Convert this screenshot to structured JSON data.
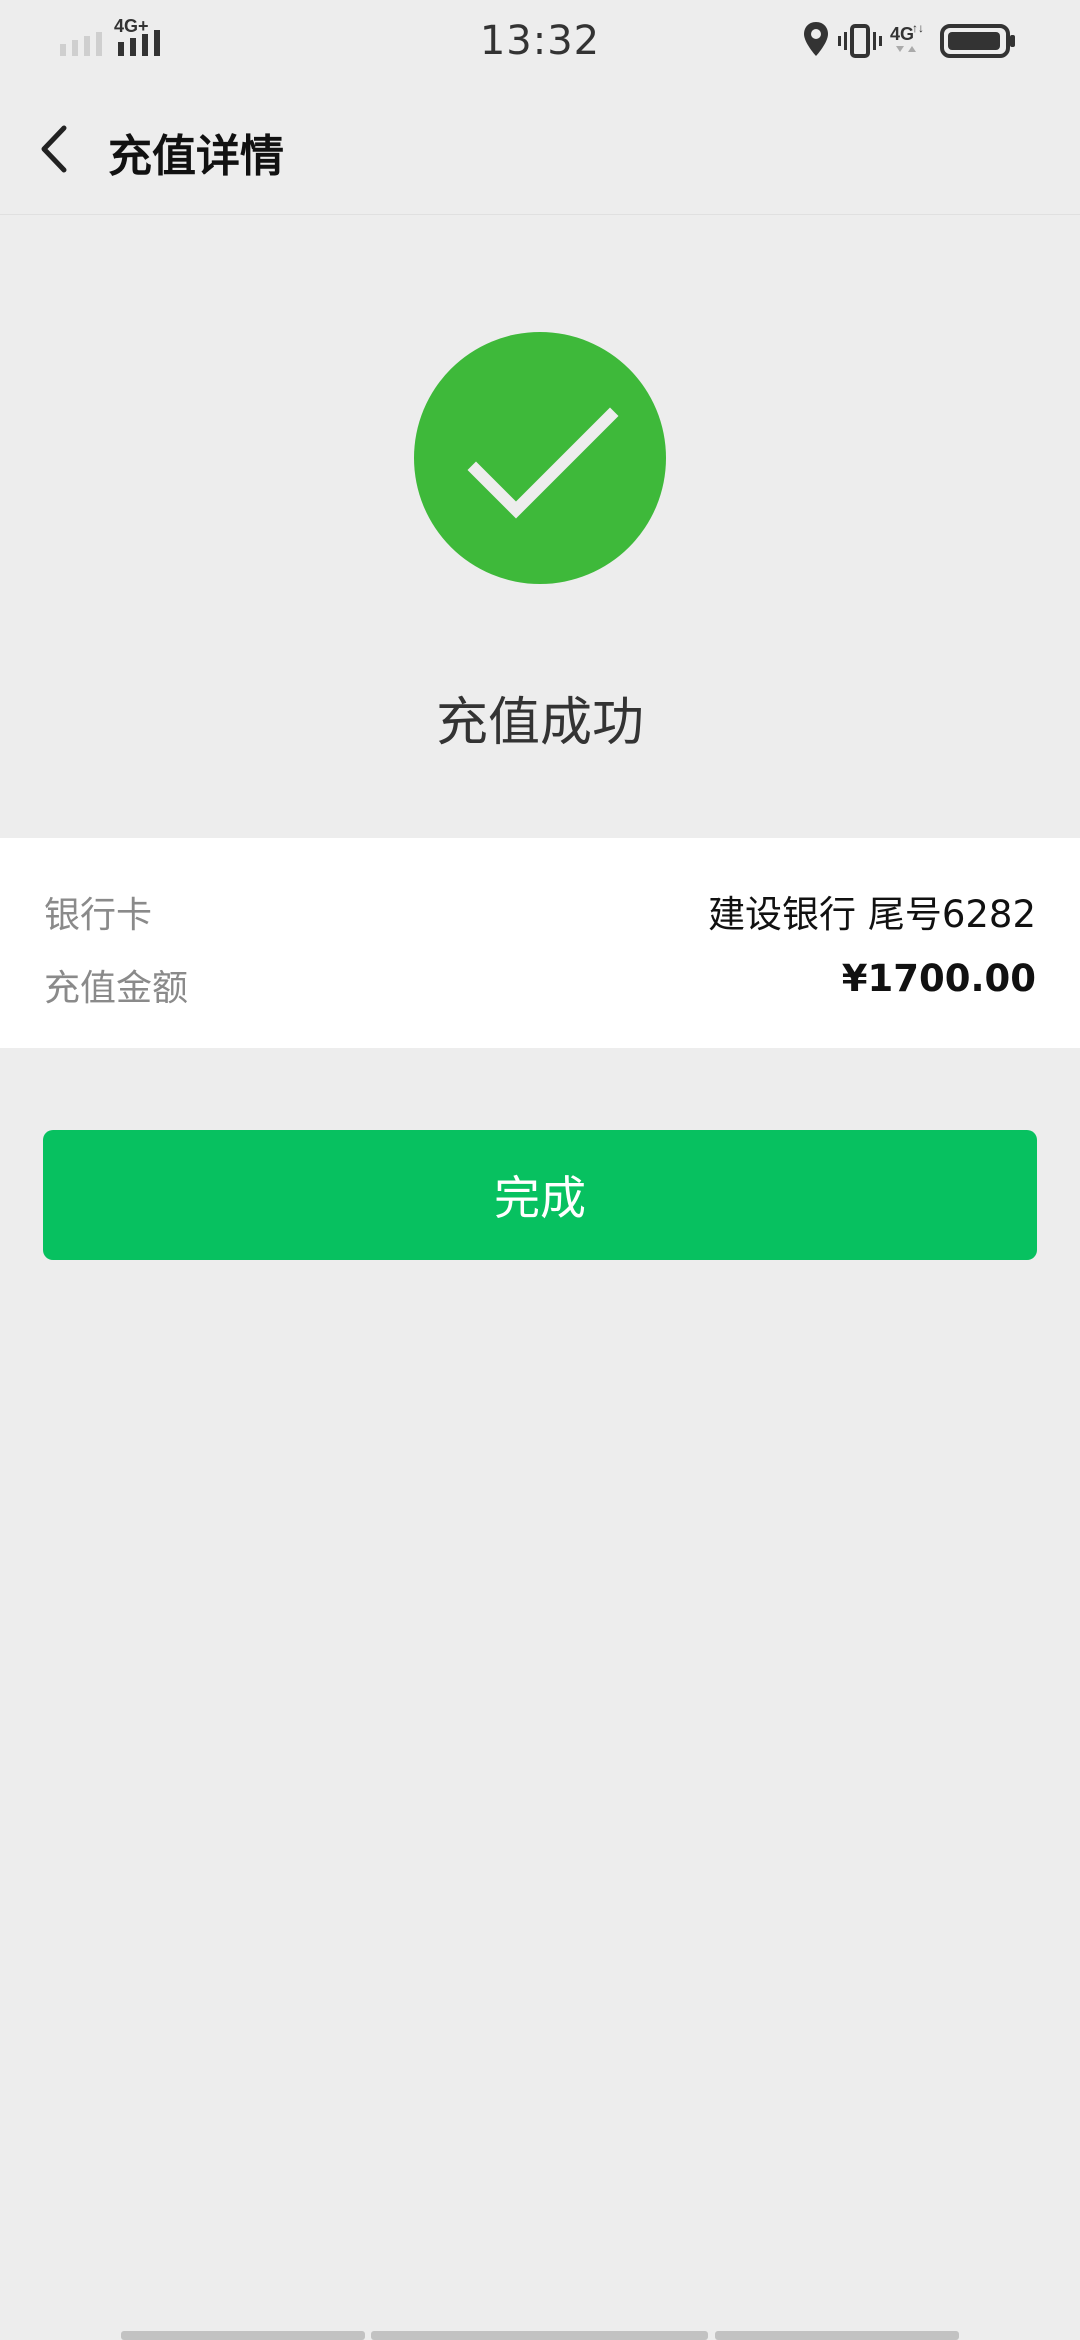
{
  "status_bar": {
    "time": "13:32",
    "network_left": "4G+",
    "network_right": "4G",
    "icons": [
      "signal-icon",
      "location-icon",
      "vibrate-icon",
      "battery-icon"
    ]
  },
  "nav": {
    "title": "充值详情",
    "back_icon": "chevron-left-icon"
  },
  "result": {
    "icon": "checkmark-circle-icon",
    "title": "充值成功"
  },
  "details": {
    "rows": [
      {
        "label": "银行卡",
        "value": "建设银行 尾号6282"
      },
      {
        "label": "充值金额",
        "value": "¥1700.00"
      }
    ]
  },
  "actions": {
    "done_label": "完成"
  },
  "colors": {
    "background": "#ededed",
    "success_green": "#3eb93a",
    "button_green": "#07c160",
    "card_white": "#ffffff"
  }
}
